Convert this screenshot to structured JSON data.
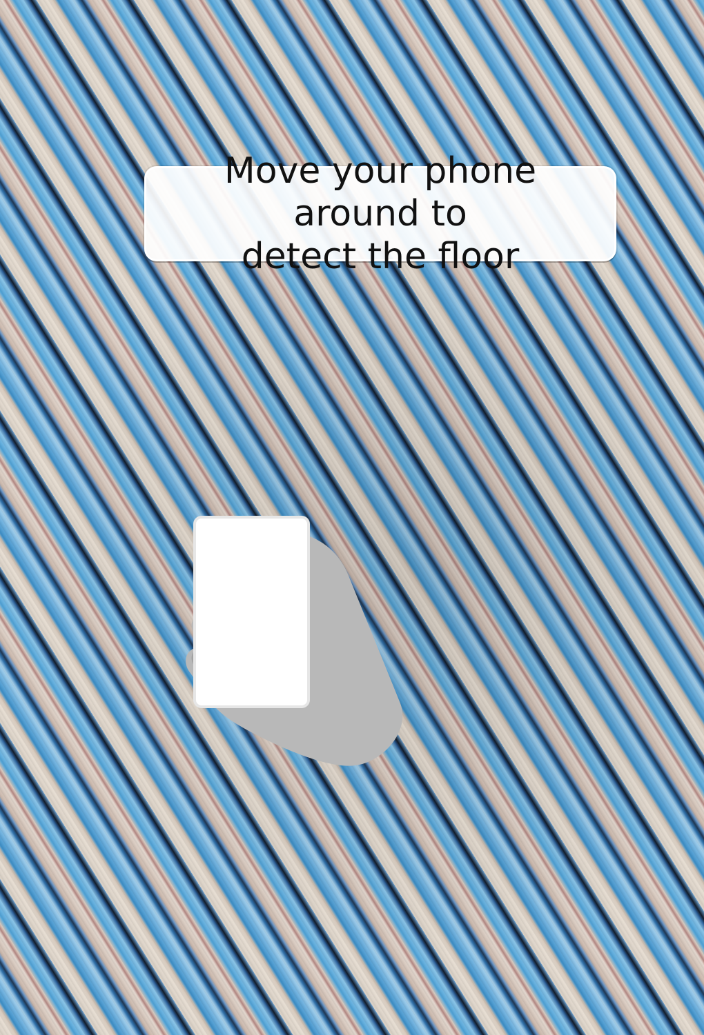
{
  "overlay": {
    "instruction": "Move your phone around to\ndetect the floor"
  },
  "illustration": {
    "icon": "phone-in-hand-icon",
    "colors": {
      "hand": "#b8b8b8",
      "hand_shadow": "#a2a2a2",
      "phone": "#ffffff",
      "phone_edge": "#e6e6e6"
    }
  }
}
